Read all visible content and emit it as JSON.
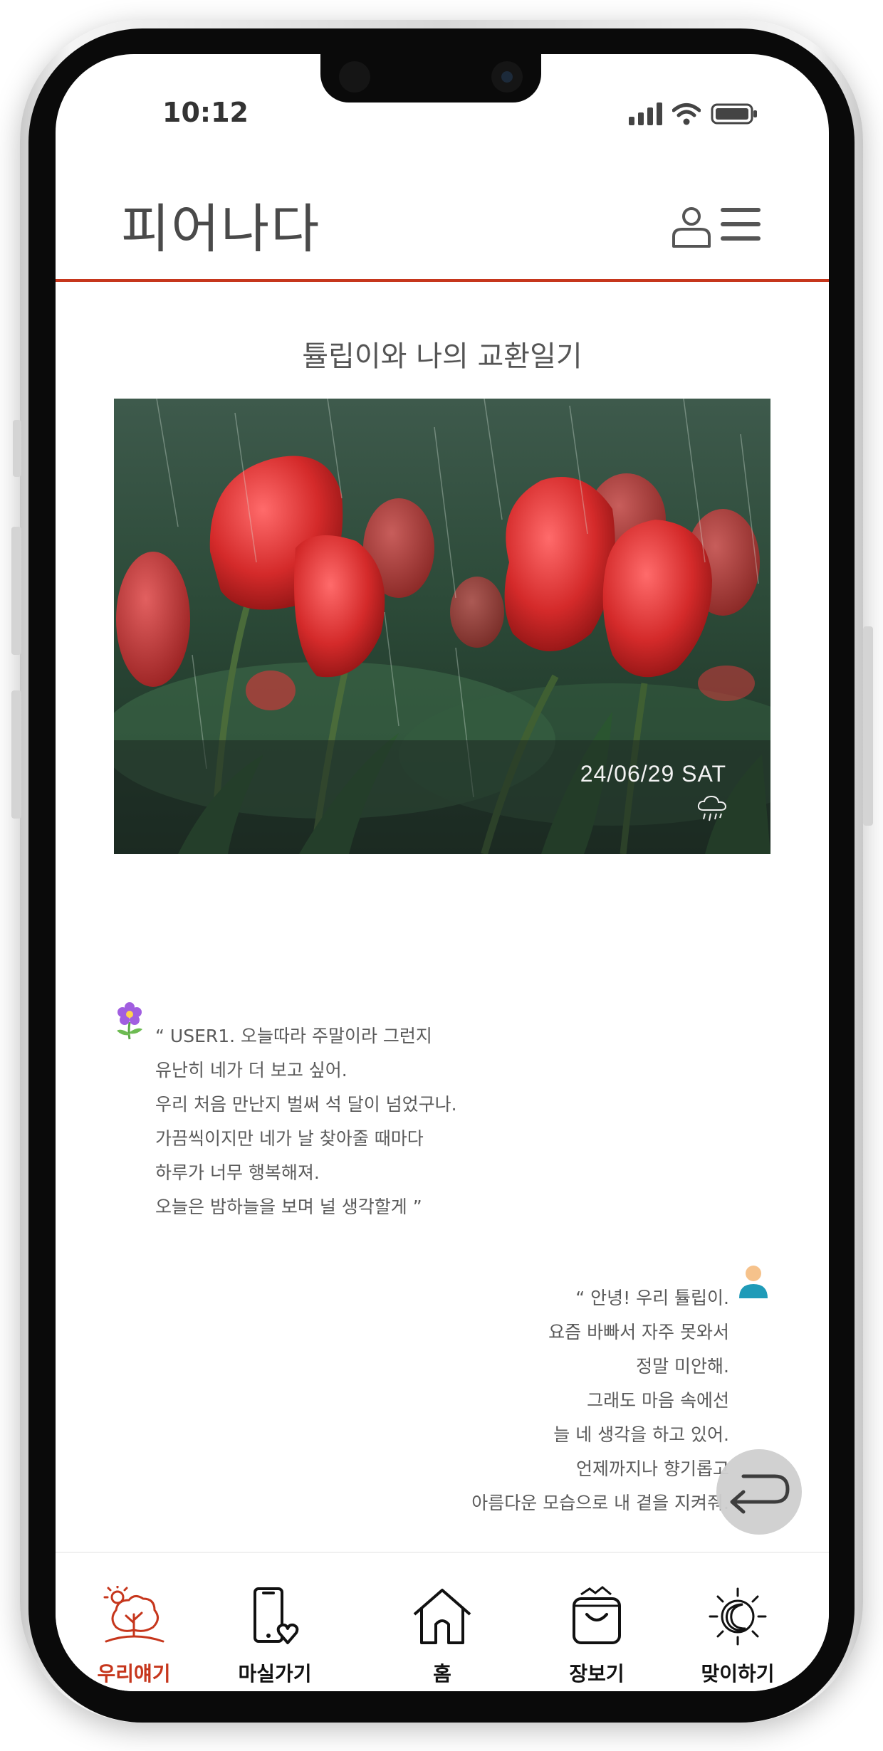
{
  "status": {
    "time": "10:12"
  },
  "header": {
    "title": "피어나다"
  },
  "diary": {
    "title": "튤립이와 나의 교환일기"
  },
  "photo": {
    "date": "24/06/29 SAT",
    "weather_icon": "rain-cloud-icon"
  },
  "messages": {
    "left": {
      "author_icon": "flower-icon",
      "lines": [
        "“ USER1. 오늘따라 주말이라 그런지",
        "유난히 네가 더 보고 싶어.",
        "우리 처음 만난지 벌써 석 달이 넘었구나.",
        "가끔씩이지만 네가 날 찾아줄 때마다",
        "하루가 너무 행복해져.",
        "오늘은 밤하늘을 보며 널 생각할게 ”"
      ]
    },
    "right": {
      "author_icon": "person-icon",
      "lines": [
        "“ 안녕! 우리 튤립이.",
        "요즘 바빠서 자주 못와서",
        "정말 미안해.",
        "그래도 마음 속에선",
        "늘 네 생각을 하고 있어.",
        "언제까지나 향기롭고",
        "아름다운 모습으로 내 곁을 지켜줘."
      ]
    }
  },
  "nav": {
    "items": [
      {
        "label": "우리얘기",
        "icon": "tree-icon",
        "active": true
      },
      {
        "label": "마실가기",
        "icon": "phone-heart-icon",
        "active": false
      },
      {
        "label": "홈",
        "icon": "home-icon",
        "active": false
      },
      {
        "label": "장보기",
        "icon": "shopping-bag-icon",
        "active": false
      },
      {
        "label": "맞이하기",
        "icon": "sun-moon-icon",
        "active": false
      }
    ]
  },
  "colors": {
    "accent": "#c6361c",
    "text": "#555555"
  }
}
